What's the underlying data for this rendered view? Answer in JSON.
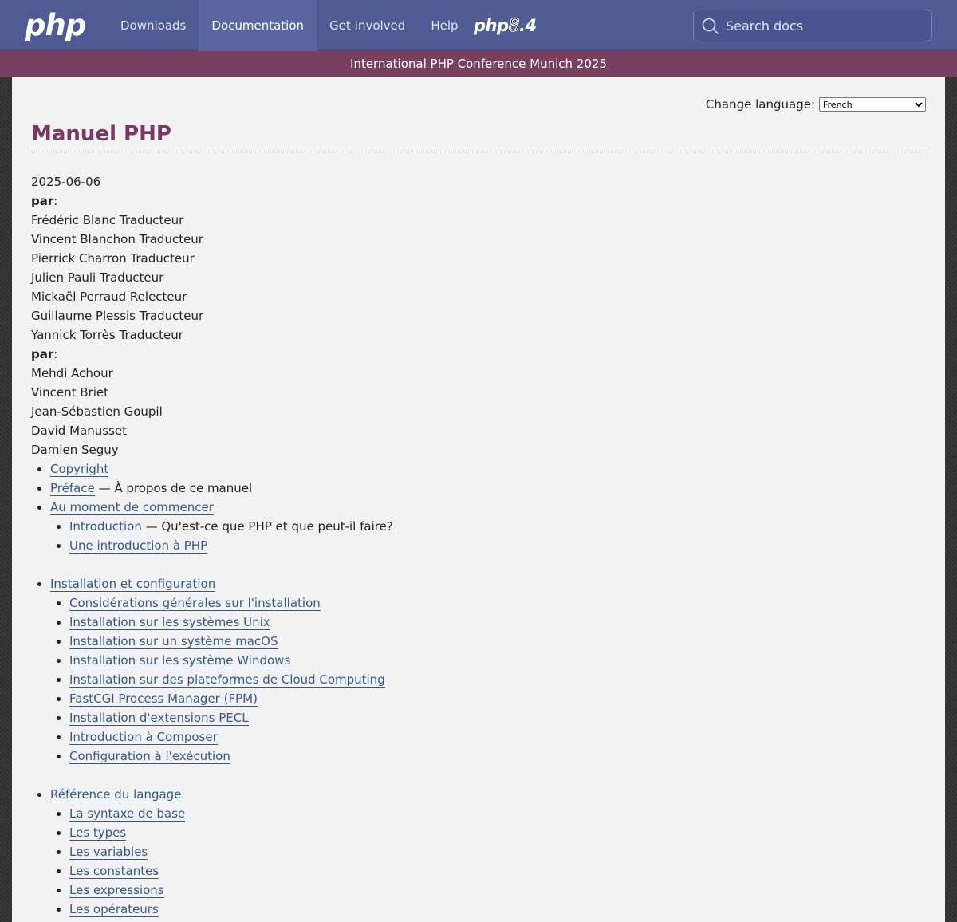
{
  "nav": {
    "logo": "php",
    "links": [
      "Downloads",
      "Documentation",
      "Get Involved",
      "Help"
    ],
    "active_index": 1,
    "version_prefix": "php",
    "version_mark": "8",
    "version_suffix": ".4",
    "search_placeholder": "Search docs"
  },
  "banner": {
    "text": "International PHP Conference Munich 2025"
  },
  "language": {
    "label": "Change language:",
    "selected": "French"
  },
  "page": {
    "title": "Manuel PHP",
    "date": "2025-06-06",
    "by_label": "par",
    "translators": [
      "Frédéric Blanc Traducteur",
      "Vincent Blanchon Traducteur",
      "Pierrick Charron Traducteur",
      "Julien Pauli Traducteur",
      "Mickaël Perraud Relecteur",
      "Guillaume Plessis Traducteur",
      "Yannick Torrès Traducteur"
    ],
    "authors": [
      "Mehdi Achour",
      "Vincent Briet",
      "Jean-Sébastien Goupil",
      "David Manusset",
      "Damien Seguy"
    ]
  },
  "toc": {
    "top": [
      {
        "link": "Copyright",
        "desc": ""
      },
      {
        "link": "Préface",
        "desc": " — À propos de ce manuel"
      }
    ],
    "groups": [
      {
        "link": "Au moment de commencer",
        "items": [
          {
            "link": "Introduction",
            "desc": " — Qu'est-ce que PHP et que peut-il faire?"
          },
          {
            "link": "Une introduction à PHP",
            "desc": ""
          }
        ]
      },
      {
        "link": "Installation et configuration",
        "items": [
          {
            "link": "Considérations générales sur l'installation",
            "desc": ""
          },
          {
            "link": "Installation sur les systèmes Unix",
            "desc": ""
          },
          {
            "link": "Installation sur un système macOS",
            "desc": ""
          },
          {
            "link": "Installation sur les système Windows",
            "desc": ""
          },
          {
            "link": "Installation sur des plateformes de Cloud Computing",
            "desc": ""
          },
          {
            "link": "FastCGI Process Manager (FPM)",
            "desc": ""
          },
          {
            "link": "Installation d'extensions PECL",
            "desc": ""
          },
          {
            "link": "Introduction à Composer",
            "desc": ""
          },
          {
            "link": "Configuration à l'exécution",
            "desc": ""
          }
        ]
      },
      {
        "link": "Référence du langage",
        "items": [
          {
            "link": "La syntaxe de base",
            "desc": ""
          },
          {
            "link": "Les types",
            "desc": ""
          },
          {
            "link": "Les variables",
            "desc": ""
          },
          {
            "link": "Les constantes",
            "desc": ""
          },
          {
            "link": "Les expressions",
            "desc": ""
          },
          {
            "link": "Les opérateurs",
            "desc": ""
          }
        ]
      }
    ]
  },
  "colors": {
    "nav_bg": "#4f5b93",
    "banner_bg": "#7b3f62",
    "title": "#793862",
    "link": "#38578d",
    "content_bg": "#f2f2f2"
  }
}
